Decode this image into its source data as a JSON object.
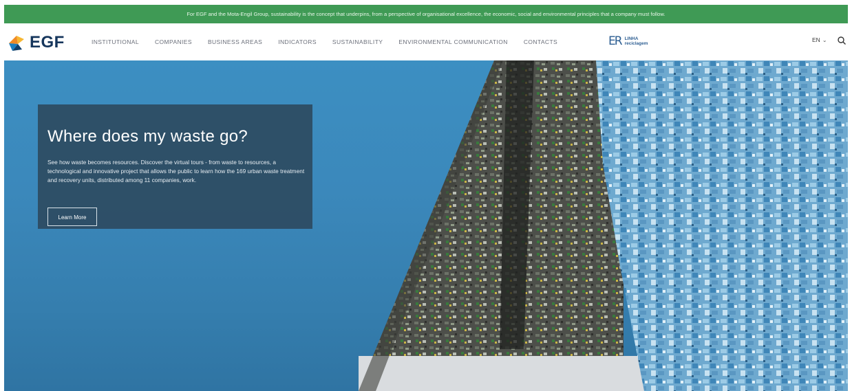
{
  "announcement": {
    "text": "For EGF and the Mota-Engil Group, sustainability is the concept that underpins, from a perspective of organisational excellence, the economic, social and environmental principles that a company must follow."
  },
  "brand": {
    "name": "EGF"
  },
  "nav": {
    "items": [
      {
        "label": "INSTITUTIONAL"
      },
      {
        "label": "COMPANIES"
      },
      {
        "label": "BUSINESS AREAS"
      },
      {
        "label": "INDICATORS"
      },
      {
        "label": "SUSTAINABILITY"
      },
      {
        "label": "ENVIRONMENTAL COMMUNICATION"
      },
      {
        "label": "CONTACTS"
      }
    ],
    "partner_logo": {
      "mark": "ER",
      "line1": "LINHA",
      "line2": "reciclagem"
    },
    "language": "EN",
    "search_icon": "search-icon"
  },
  "hero": {
    "title": "Where does my waste go?",
    "description": "See how waste becomes resources. Discover the virtual tours - from waste to resources, a technological and innovative project that allows the public to learn how the 169 urban waste treatment and recovery units, distributed among 11 companies, work.",
    "button": "Learn More"
  },
  "colors": {
    "announcement_bar": "#3f9a55",
    "hero_blue": "#3b88bb",
    "card_background": "#2e4b61",
    "brand_navy": "#16365c"
  }
}
